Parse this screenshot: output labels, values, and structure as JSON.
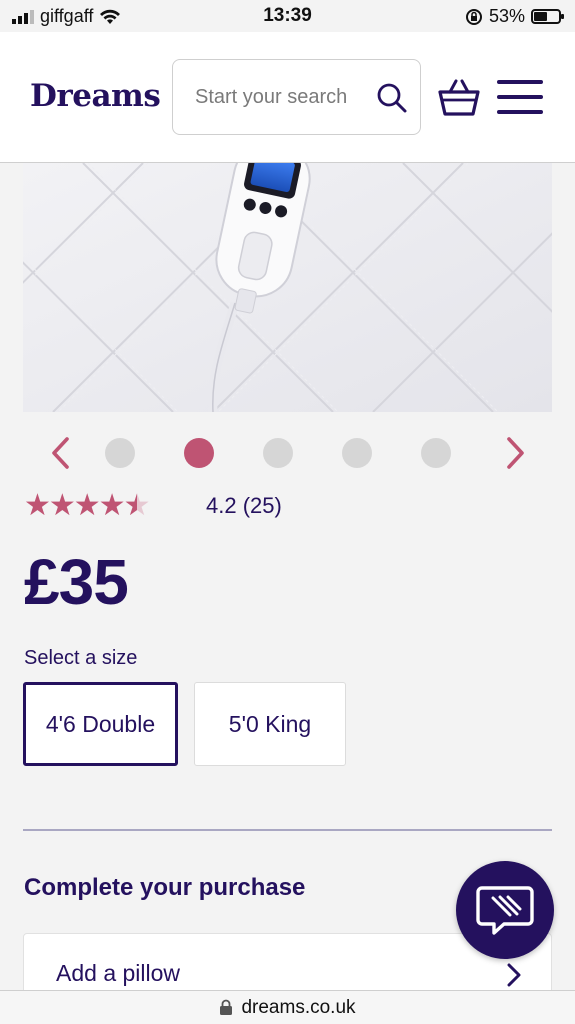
{
  "status_bar": {
    "carrier": "giffgaff",
    "time": "13:39",
    "battery": "53%",
    "battery_level": 0.53,
    "icons": [
      "signal-icon",
      "wifi-icon",
      "orientation-lock-icon",
      "battery-icon"
    ]
  },
  "header": {
    "logo": "Dreams",
    "search_placeholder": "Start your search",
    "icons": [
      "search-icon",
      "basket-icon",
      "menu-icon"
    ],
    "brand_color": "#24115e"
  },
  "carousel": {
    "dot_count": 5,
    "active_index": 1,
    "accent_color": "#bf5473",
    "icons": [
      "chevron-left-icon",
      "chevron-right-icon"
    ]
  },
  "rating": {
    "stars_value": 4.2,
    "stars_max": 5,
    "text": "4.2 (25)"
  },
  "price": "£35",
  "size_selector": {
    "label": "Select a size",
    "options": [
      {
        "label": "4'6 Double",
        "selected": true
      },
      {
        "label": "5'0 King",
        "selected": false
      }
    ]
  },
  "complete_purchase": {
    "title": "Complete your purchase",
    "items": [
      {
        "label": "Add a pillow"
      }
    ]
  },
  "url_bar": {
    "domain": "dreams.co.uk"
  }
}
